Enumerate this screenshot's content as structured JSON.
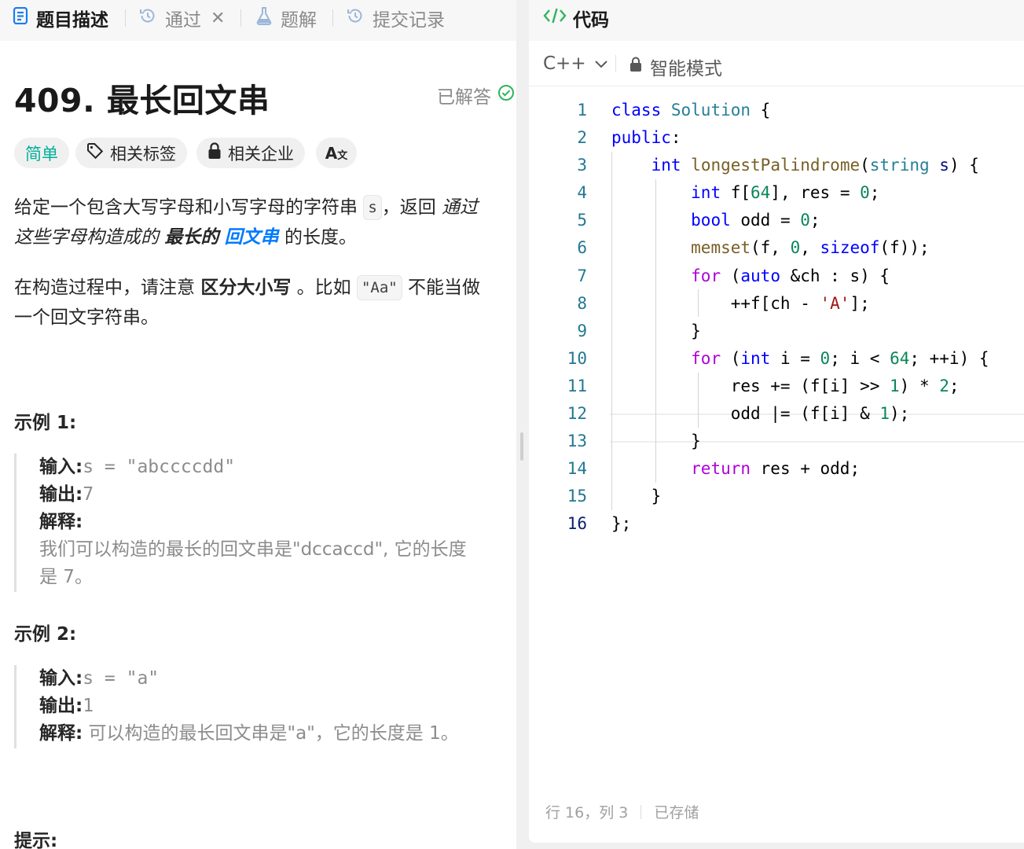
{
  "left_tabs": [
    {
      "label": "题目描述",
      "icon": "document-icon",
      "active": true
    },
    {
      "label": "通过",
      "icon": "history-icon",
      "close": "✕"
    },
    {
      "label": "题解",
      "icon": "flask-icon"
    },
    {
      "label": "提交记录",
      "icon": "history-icon"
    }
  ],
  "problem": {
    "title": "409. 最长回文串",
    "status": "已解答",
    "chips": {
      "difficulty": "简单",
      "tags": "相关标签",
      "companies": "相关企业",
      "translate": "A",
      "translate_sub": "文"
    },
    "desc1": {
      "a": "给定一个包含大写字母和小写字母的字符串",
      "code": "s",
      "b": "，返回",
      "c": "通过",
      "line2_a": "这些字母构造成的",
      "bold1": "最长的",
      "bold2": "回文串",
      "line2_b": "的长度。"
    },
    "desc2": {
      "a": "在构造过程中，请注意",
      "bold": "区分大小写",
      "b": "。比如",
      "code": "\"Aa\"",
      "c": "不能当做",
      "line2": "一个回文字符串。"
    },
    "examples": [
      {
        "title": "示例 1:",
        "input_label": "输入:",
        "input": "s = \"abccccdd\"",
        "output_label": "输出:",
        "output": "7",
        "explain_label": "解释:",
        "explain": "我们可以构造的最长的回文串是\"dccaccd\", 它的长度",
        "explain2": "是 7。"
      },
      {
        "title": "示例 2:",
        "input_label": "输入:",
        "input": "s = \"a\"",
        "output_label": "输出:",
        "output": "1",
        "explain_label": "解释:",
        "explain": "可以构造的最长回文串是\"a\"，它的长度是 1。"
      }
    ],
    "hints_title": "提示:"
  },
  "editor": {
    "tab": "代码",
    "language": "C++",
    "mode": "智能模式",
    "line_numbers": [
      "1",
      "2",
      "3",
      "4",
      "5",
      "6",
      "7",
      "8",
      "9",
      "10",
      "11",
      "12",
      "13",
      "14",
      "15",
      "16"
    ],
    "status_position": "行 16，列 3",
    "status_saved": "已存储"
  },
  "colors": {
    "accent_blue": "#007aff",
    "easy_green": "#00af9b",
    "solved_green": "#2db55d"
  }
}
